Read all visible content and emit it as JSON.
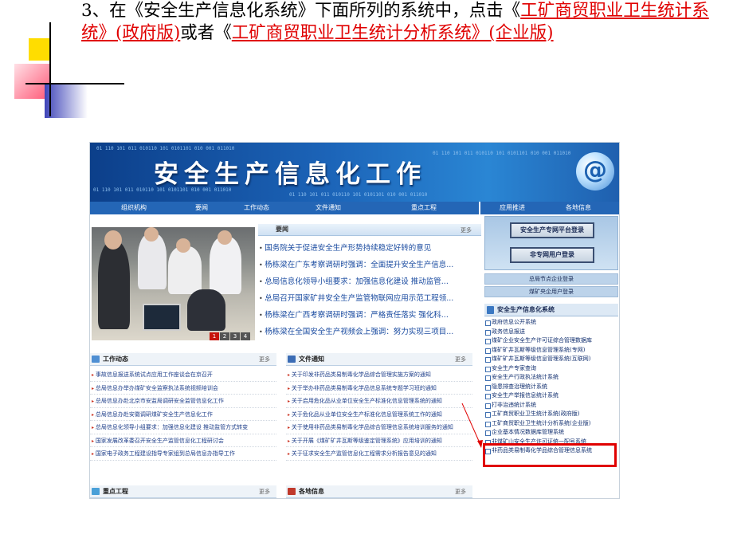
{
  "slide": {
    "instruction_part1": "3、在《安全生产信息化系统》下面所列的系统中，点击《",
    "link1": "工矿商贸职业卫生统计系统》(政府版)",
    "instruction_part2": "或者《",
    "link2": "工矿商贸职业卫生统计分析系统》(企业版)"
  },
  "header": {
    "title": "安全生产信息化工作",
    "binary_text": "01 110 101 011 010110 101 0101101 010 001 011010"
  },
  "nav": {
    "items": [
      "组织机构",
      "要闻",
      "工作动态",
      "文件通知",
      "重点工程",
      "应用推进",
      "各地信息"
    ]
  },
  "photo": {
    "pager": [
      "1",
      "2",
      "3",
      "4"
    ]
  },
  "news": {
    "title": "要闻",
    "more": "更多",
    "items": [
      "国务院关于促进安全生产形势持续稳定好转的意见",
      "杨栋梁在广东考察调研时强调：全面提升安全生产信息...",
      "总局信息化领导小组要求：加强信息化建设 推动监管...",
      "总局召开国家矿井安全生产监管物联网应用示范工程领...",
      "杨栋梁在广西考察调研时强调：严格责任落实 强化科...",
      "杨栋梁在全国安全生产视频会上强调：努力实现三项目..."
    ]
  },
  "work": {
    "title": "工作动态",
    "more": "更多",
    "items": [
      "事故信息报送系统试点应用工作座谈会在京召开",
      "总局信息办举办煤矿安全监察执法系统视频培训会",
      "总局信息办赴北京市安监局调研安全监管信息化工作",
      "总局信息办赴安徽调研煤矿安全生产信息化工作",
      "总局信息化领导小组要求：加强信息化建设 推动监管方式转变",
      "国家发展改革委召开安全生产监管信息化工程研讨会",
      "国家电子政务工程建设指导专家组到总局信息办指导工作"
    ]
  },
  "notice": {
    "title": "文件通知",
    "more": "更多",
    "items": [
      "关于印发非药品类易制毒化学品综合管理实施方案的通知",
      "关于举办非药品类易制毒化学品信息系统专题学习班的通知",
      "关于启用危化品从业单位安全生产标准化信息管理系统的通知",
      "关于危化品从业单位安全生产标准化信息管理系统工作的通知",
      "关于使用非药品类易制毒化学品综合管理信息系统培训服务的通知",
      "关于开展《煤矿矿井瓦斯等级鉴定管理系统》应用培训的通知",
      "关于征求安全生产监管信息化工程需求分析报告意见的通知"
    ]
  },
  "key_projects": {
    "title": "重点工程",
    "more": "更多"
  },
  "local_info": {
    "title": "各地信息",
    "more": "更多"
  },
  "right": {
    "login_main": "安全生产专网平台登录",
    "login_other": "非专网用户登录",
    "bar1": "总局节点企业登录",
    "bar2": "煤矿央企用户登录",
    "systems_title": "安全生产信息化系统",
    "systems": [
      "政府信息公开系统",
      "政务信息报送",
      "煤矿企业安全生产许可证综合管理数据库",
      "煤矿矿井瓦斯等级信息管理系统(专网)",
      "煤矿矿井瓦斯等级信息管理系统(互联网)",
      "安全生产专家查询",
      "安全生产行政执法统计系统",
      "隐患排查治理统计系统",
      "安全生产举报信息统计系统",
      "打非治违统计系统",
      "工矿商贸职业卫生统计系统(政府版)",
      "工矿商贸职业卫生统计分析系统(企业版)",
      "企业基本情况数据库管理系统",
      "非煤矿山安全生产许可证统一配号系统",
      "非药品类易制毒化学品综合管理信息系统"
    ]
  }
}
